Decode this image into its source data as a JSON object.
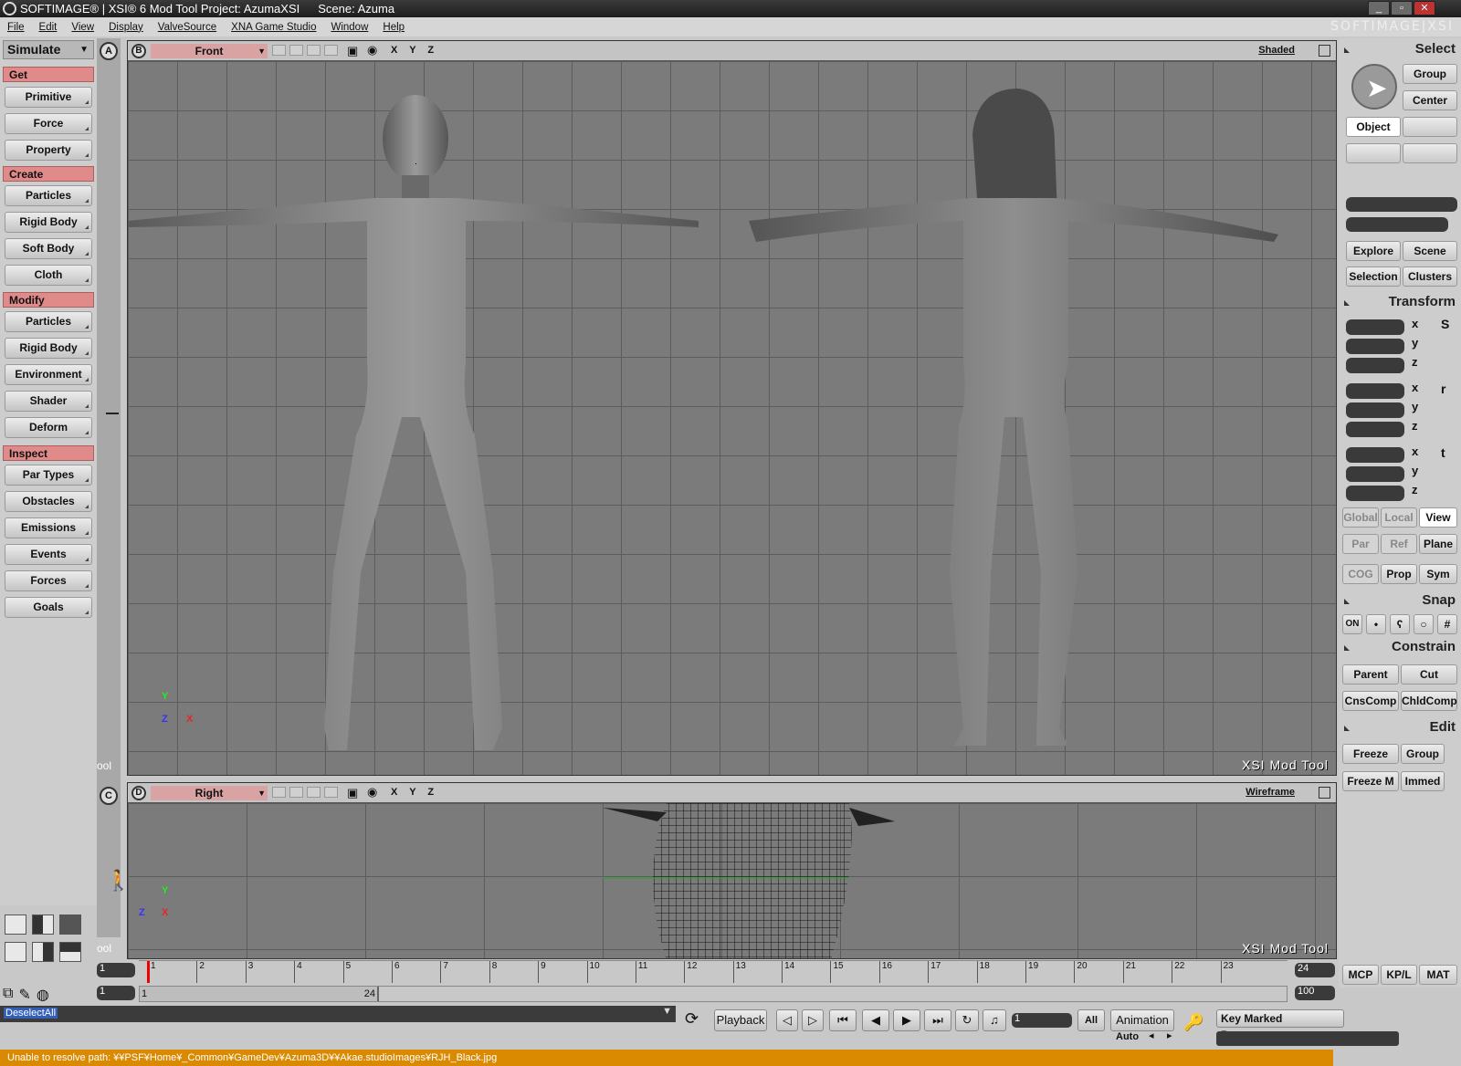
{
  "titlebar": {
    "app": "SOFTIMAGE® | XSI® 6 Mod Tool Project: AzumaXSI",
    "scene": "Scene: Azuma",
    "brand": "SOFTIMAGE|XSI"
  },
  "menu": [
    "File",
    "Edit",
    "View",
    "Display",
    "ValveSource",
    "XNA Game Studio",
    "Window",
    "Help"
  ],
  "left": {
    "mode": "Simulate",
    "sections": {
      "get": "Get",
      "create": "Create",
      "modify": "Modify",
      "inspect": "Inspect"
    },
    "get_items": [
      "Primitive",
      "Force",
      "Property"
    ],
    "create_items": [
      "Particles",
      "Rigid Body",
      "Soft Body",
      "Cloth"
    ],
    "modify_items": [
      "Particles",
      "Rigid Body",
      "Environment",
      "Shader",
      "Deform"
    ],
    "inspect_items": [
      "Par Types",
      "Obstacles",
      "Emissions",
      "Events",
      "Forces",
      "Goals"
    ]
  },
  "vstrip": {
    "a": "A",
    "c": "C",
    "tool_label_1": "ool",
    "tool_label_2": "ool"
  },
  "vp_top": {
    "letter": "B",
    "name": "Front",
    "mode": "Shaded",
    "xyz": "X Y Z",
    "watermark": "XSI Mod Tool",
    "axis_y": "Y",
    "axis_z": "Z",
    "axis_x": "X"
  },
  "vp_bot": {
    "letter": "D",
    "name": "Right",
    "mode": "Wireframe",
    "xyz": "X Y Z",
    "watermark": "XSI Mod Tool",
    "axis_y": "Y",
    "axis_z": "Z",
    "axis_x": "X"
  },
  "right": {
    "select": "Select",
    "group": "Group",
    "center": "Center",
    "object": "Object",
    "explore": "Explore",
    "scene": "Scene",
    "selection": "Selection",
    "clusters": "Clusters",
    "transform": "Transform",
    "axes": [
      "x",
      "y",
      "z"
    ],
    "side_s": "S",
    "side_r": "r",
    "side_t": "t",
    "global": "Global",
    "local": "Local",
    "view": "View",
    "par": "Par",
    "ref": "Ref",
    "plane": "Plane",
    "cog": "COG",
    "prop": "Prop",
    "sym": "Sym",
    "snap": "Snap",
    "on": "ON",
    "constrain": "Constrain",
    "parent": "Parent",
    "cut": "Cut",
    "cnscomp": "CnsComp",
    "chldcomp": "ChldComp",
    "edit": "Edit",
    "freeze": "Freeze",
    "group2": "Group",
    "freezem": "Freeze M",
    "immed": "Immed",
    "mcp": "MCP",
    "kpl": "KP/L",
    "mat": "MAT"
  },
  "timeline": {
    "start": "1",
    "end": "24",
    "ticks": [
      "1",
      "2",
      "3",
      "4",
      "5",
      "6",
      "7",
      "8",
      "9",
      "10",
      "11",
      "12",
      "13",
      "14",
      "15",
      "16",
      "17",
      "18",
      "19",
      "20",
      "21",
      "22",
      "23"
    ],
    "range_start": "1",
    "range_inner_start": "1",
    "range_inner_end": "24",
    "range_end": "100"
  },
  "bottom": {
    "cmd": "DeselectAll",
    "playback": "Playback",
    "frame": "1",
    "all": "All",
    "animation": "Animation",
    "auto": "Auto",
    "key_marked": "Key Marked Parameters"
  },
  "status": "Unable to resolve path: ¥¥PSF¥Home¥_Common¥GameDev¥Azuma3D¥¥Akae.studioImages¥RJH_Black.jpg"
}
